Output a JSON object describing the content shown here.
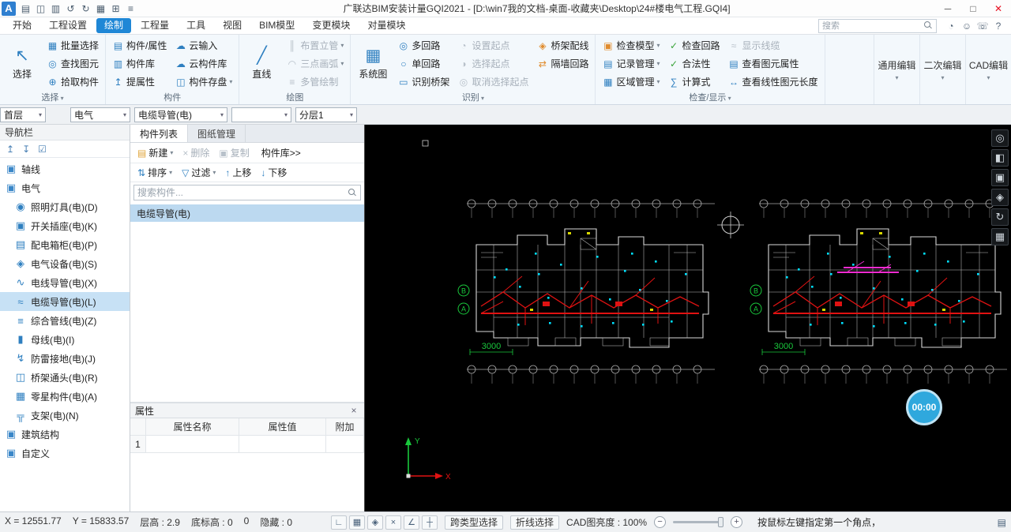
{
  "window": {
    "title": "广联达BIM安装计量GQI2021 - [D:\\win7我的文档-桌面-收藏夹\\Desktop\\24#楼电气工程.GQI4]",
    "logo": "A",
    "minimize": "─",
    "maximize": "□",
    "close": "✕"
  },
  "quick_access": [
    {
      "icon": "▤"
    },
    {
      "icon": "◫"
    },
    {
      "icon": "▥"
    },
    {
      "icon": "↺"
    },
    {
      "icon": "↻"
    },
    {
      "icon": "▦"
    },
    {
      "icon": "⊞"
    },
    {
      "icon": "≡"
    }
  ],
  "menubar": {
    "tabs": [
      {
        "label": "开始"
      },
      {
        "label": "工程设置"
      },
      {
        "label": "绘制",
        "active": true
      },
      {
        "label": "工程量"
      },
      {
        "label": "工具"
      },
      {
        "label": "视图"
      },
      {
        "label": "BIM模型"
      },
      {
        "label": "变更模块"
      },
      {
        "label": "对量模块"
      }
    ],
    "search_placeholder": "搜索",
    "right_icons": [
      {
        "icon": "◔"
      },
      {
        "icon": "☺"
      },
      {
        "icon": "☏"
      },
      {
        "icon": "?"
      }
    ]
  },
  "ribbon": {
    "g1": {
      "label": "选择",
      "big": {
        "label": "选择",
        "icon": "↖"
      },
      "items": [
        {
          "label": "批量选择",
          "icon": "▦"
        },
        {
          "label": "查找图元",
          "icon": "◎"
        },
        {
          "label": "拾取构件",
          "icon": "⊕"
        }
      ]
    },
    "g2": {
      "label": "构件",
      "items": [
        {
          "label": "构件/属性",
          "icon": "▤"
        },
        {
          "label": "构件库",
          "icon": "▥"
        },
        {
          "label": "提属性",
          "icon": "↥"
        },
        {
          "label": "云输入",
          "icon": "☁"
        },
        {
          "label": "云构件库",
          "icon": "☁"
        },
        {
          "label": "构件存盘",
          "icon": "◫",
          "arrow": true
        }
      ]
    },
    "g3": {
      "label": "绘图",
      "big": {
        "label": "直线",
        "icon": "╱"
      },
      "items": [
        {
          "label": "布置立管",
          "icon": "║",
          "arrow": true,
          "disabled": true
        },
        {
          "label": "三点画弧",
          "icon": "◠",
          "arrow": true,
          "disabled": true
        },
        {
          "label": "多管绘制",
          "icon": "≡",
          "disabled": true
        }
      ]
    },
    "g4": {
      "label": "识别",
      "big": {
        "label": "系统图",
        "icon": "▦"
      },
      "items": [
        {
          "label": "多回路",
          "icon": "◎"
        },
        {
          "label": "单回路",
          "icon": "○"
        },
        {
          "label": "识别桥架",
          "icon": "▭"
        },
        {
          "label": "设置起点",
          "icon": "◔",
          "disabled": true
        },
        {
          "label": "选择起点",
          "icon": "◑",
          "disabled": true
        },
        {
          "label": "取消选择起点",
          "icon": "◎",
          "disabled": true
        },
        {
          "label": "桥架配线",
          "icon": "◈",
          "orange": true
        },
        {
          "label": "隔墙回路",
          "icon": "⇄",
          "orange": true
        }
      ]
    },
    "g5": {
      "label": "检查/显示",
      "items": [
        {
          "label": "检查模型",
          "icon": "▣",
          "arrow": true,
          "orange": true
        },
        {
          "label": "记录管理",
          "icon": "▤",
          "arrow": true
        },
        {
          "label": "区域管理",
          "icon": "▦",
          "arrow": true
        },
        {
          "label": "检查回路",
          "icon": "✓",
          "green": true
        },
        {
          "label": "合法性",
          "icon": "✓",
          "green": true
        },
        {
          "label": "计算式",
          "icon": "∑"
        },
        {
          "label": "显示线缆",
          "icon": "≈",
          "disabled": true
        },
        {
          "label": "查看图元属性",
          "icon": "▤"
        },
        {
          "label": "查看线性图元长度",
          "icon": "↔"
        }
      ]
    },
    "edit_buttons": [
      {
        "label": "通用编辑"
      },
      {
        "label": "二次编辑"
      },
      {
        "label": "CAD编辑"
      }
    ]
  },
  "selectors": [
    {
      "value": "首层"
    },
    {
      "value": "电气"
    },
    {
      "value": "电缆导管(电)"
    },
    {
      "value": ""
    },
    {
      "value": "分层1"
    }
  ],
  "navigator": {
    "title": "导航栏",
    "tools": [
      {
        "icon": "↥"
      },
      {
        "icon": "↧"
      },
      {
        "icon": "☑"
      }
    ],
    "items": [
      {
        "label": "轴线",
        "icon": "▣",
        "group": true
      },
      {
        "label": "电气",
        "icon": "▣",
        "group": true
      },
      {
        "label": "照明灯具(电)(D)",
        "icon": "◉",
        "child": true
      },
      {
        "label": "开关插座(电)(K)",
        "icon": "▣",
        "child": true
      },
      {
        "label": "配电箱柜(电)(P)",
        "icon": "▤",
        "child": true
      },
      {
        "label": "电气设备(电)(S)",
        "icon": "◈",
        "child": true
      },
      {
        "label": "电线导管(电)(X)",
        "icon": "∿",
        "child": true
      },
      {
        "label": "电缆导管(电)(L)",
        "icon": "≈",
        "child": true,
        "selected": true
      },
      {
        "label": "综合管线(电)(Z)",
        "icon": "≡",
        "child": true
      },
      {
        "label": "母线(电)(I)",
        "icon": "▮",
        "child": true
      },
      {
        "label": "防雷接地(电)(J)",
        "icon": "↯",
        "child": true
      },
      {
        "label": "桥架通头(电)(R)",
        "icon": "◫",
        "child": true
      },
      {
        "label": "零星构件(电)(A)",
        "icon": "▦",
        "child": true
      },
      {
        "label": "支架(电)(N)",
        "icon": "╦",
        "child": true
      },
      {
        "label": "建筑结构",
        "icon": "▣",
        "group": true
      },
      {
        "label": "自定义",
        "icon": "▣",
        "group": true
      }
    ]
  },
  "component_panel": {
    "tabs": [
      {
        "label": "构件列表",
        "active": true
      },
      {
        "label": "图纸管理"
      }
    ],
    "toolbar1": [
      {
        "label": "新建",
        "icon": "▤",
        "arrow": true
      },
      {
        "label": "删除",
        "icon": "×",
        "disabled": true
      },
      {
        "label": "复制",
        "icon": "▣",
        "disabled": true
      },
      {
        "label": "构件库>>",
        "icon": ""
      }
    ],
    "toolbar2": [
      {
        "label": "排序",
        "icon": "⇅",
        "arrow": true
      },
      {
        "label": "过滤",
        "icon": "▽",
        "arrow": true
      },
      {
        "label": "上移",
        "icon": "↑"
      },
      {
        "label": "下移",
        "icon": "↓"
      }
    ],
    "search_placeholder": "搜索构件...",
    "items": [
      {
        "label": "电缆导管(电)",
        "selected": true
      }
    ]
  },
  "properties_panel": {
    "title": "属性",
    "close": "×",
    "columns": [
      "属性名称",
      "属性值",
      "附加"
    ],
    "row_num": "1"
  },
  "canvas": {
    "dim_label": "3000",
    "axis_b": "B",
    "axis_a": "A",
    "axis_x": "X",
    "axis_y": "Y",
    "timer": "00:00",
    "view_tools": [
      {
        "icon": "◎"
      },
      {
        "icon": "◧"
      },
      {
        "icon": "▣"
      },
      {
        "icon": "◈"
      },
      {
        "icon": "↻"
      },
      {
        "icon": "▦"
      }
    ]
  },
  "statusbar": {
    "fields": [
      {
        "text": "X = 12551.77"
      },
      {
        "text": "Y = 15833.57"
      },
      {
        "text": "层高 : 2.9"
      },
      {
        "text": "底标高 : 0"
      },
      {
        "text": "0"
      },
      {
        "text": "隐藏 : 0"
      }
    ],
    "snap_icons": [
      {
        "icon": "∟"
      },
      {
        "icon": "▦",
        "arrow": true
      },
      {
        "icon": "◈",
        "arrow": true
      },
      {
        "icon": "×"
      },
      {
        "icon": "∠",
        "arrow": true
      },
      {
        "icon": "┼",
        "arrow": true
      }
    ],
    "cross_type": "跨类型选择",
    "polyline_select": "折线选择",
    "brightness": "CAD图亮度 : 100%",
    "minus": "−",
    "plus": "+",
    "hint": "按鼠标左键指定第一个角点，",
    "right_icon": "▤"
  },
  "colors": {
    "accent": "#1f87d6",
    "selected_bg": "#c7e1f5",
    "canvas_bg": "#000000",
    "cad_line": "#d8d8d8",
    "wire_red": "#e01212",
    "device_cyan": "#00e0ff",
    "axis_green": "#19c83c",
    "magenta": "#f02bd0",
    "timer_blue": "#2fa8dd"
  }
}
